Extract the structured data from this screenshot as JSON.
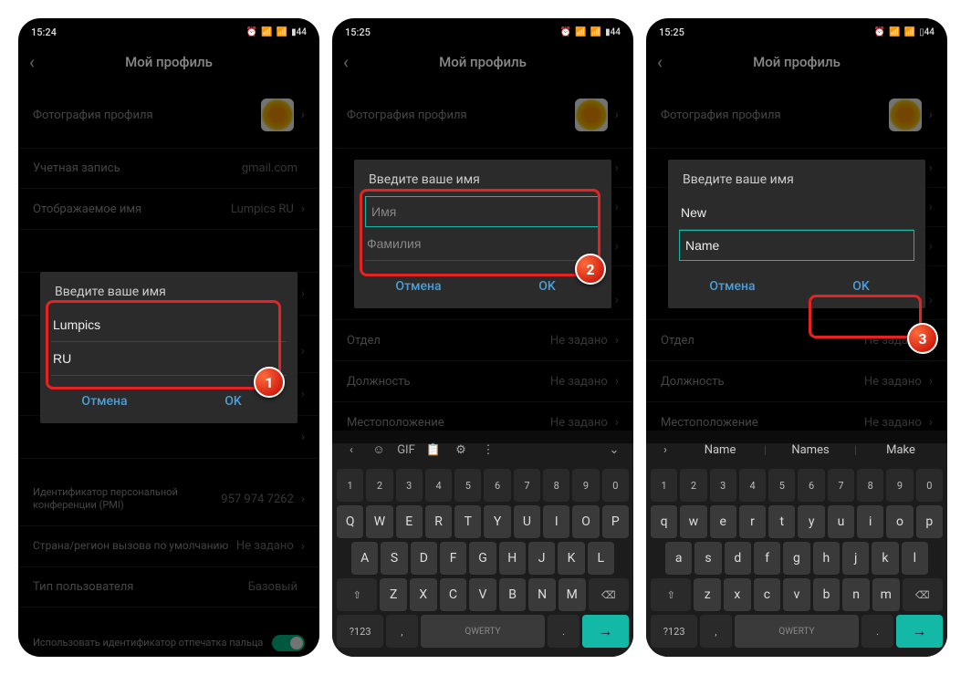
{
  "screens": [
    {
      "time": "15:24",
      "battery": "44",
      "title": "Мой профиль",
      "rows": {
        "photo": "Фотография профиля",
        "account": {
          "label": "Учетная запись",
          "value": "gmail.com"
        },
        "display_name": {
          "label": "Отображаемое имя",
          "value": "Lumpics RU"
        },
        "pmi": {
          "label": "Идентификатор персональной конференции (PMI)",
          "value": "957 974 7262"
        },
        "region": {
          "label": "Страна/регион вызова по умолчанию",
          "value": "Не задано"
        },
        "user_type": {
          "label": "Тип пользователя",
          "value": "Базовый"
        },
        "fingerprint": "Использовать идентификатор отпечатка пальца"
      },
      "dialog": {
        "title": "Введите ваше имя",
        "first_name": "Lumpics",
        "last_name": "RU",
        "cancel": "Отмена",
        "ok": "OK"
      },
      "badge": "1"
    },
    {
      "time": "15:25",
      "battery": "44",
      "title": "Мой профиль",
      "rows": {
        "photo": "Фотография профиля",
        "dept": {
          "label": "Отдел",
          "value": "Не задано"
        },
        "position": {
          "label": "Должность",
          "value": "Не задано"
        },
        "location": {
          "label": "Местоположение",
          "value": "Не задано"
        }
      },
      "dialog": {
        "title": "Введите ваше имя",
        "first_placeholder": "Имя",
        "last_placeholder": "Фамилия",
        "cancel": "Отмена",
        "ok": "OK"
      },
      "keyboard": {
        "suggest_icons": [
          "‹",
          "☺",
          "GIF",
          "📋",
          "⚙",
          "⋮",
          "⌄"
        ],
        "row_num": [
          "1",
          "2",
          "3",
          "4",
          "5",
          "6",
          "7",
          "8",
          "9",
          "0"
        ],
        "row1": [
          "Q",
          "W",
          "E",
          "R",
          "T",
          "Y",
          "U",
          "I",
          "O",
          "P"
        ],
        "row2": [
          "A",
          "S",
          "D",
          "F",
          "G",
          "H",
          "J",
          "K",
          "L"
        ],
        "row3_shift": "⇧",
        "row3": [
          "Z",
          "X",
          "C",
          "V",
          "B",
          "N",
          "M"
        ],
        "row3_del": "⌫",
        "sym": "?123",
        "comma": ",",
        "space": "QWERTY",
        "period": ".",
        "enter": "→"
      },
      "badge": "2"
    },
    {
      "time": "15:25",
      "battery": "44",
      "title": "Мой профиль",
      "rows": {
        "photo": "Фотография профиля",
        "dept": {
          "label": "Отдел",
          "value": "Не задано"
        },
        "position": {
          "label": "Должность",
          "value": "Не задано"
        },
        "location": {
          "label": "Местоположение",
          "value": "Не задано"
        }
      },
      "dialog": {
        "title": "Введите ваше имя",
        "first_name": "New",
        "last_name": "Name",
        "cancel": "Отмена",
        "ok": "OK"
      },
      "keyboard": {
        "suggest": [
          "Name",
          "Names",
          "Make"
        ],
        "row_num": [
          "1",
          "2",
          "3",
          "4",
          "5",
          "6",
          "7",
          "8",
          "9",
          "0"
        ],
        "row1": [
          "q",
          "w",
          "e",
          "r",
          "t",
          "y",
          "u",
          "i",
          "o",
          "p"
        ],
        "row2": [
          "a",
          "s",
          "d",
          "f",
          "g",
          "h",
          "j",
          "k",
          "l"
        ],
        "row3_shift": "⇧",
        "row3": [
          "z",
          "x",
          "c",
          "v",
          "b",
          "n",
          "m"
        ],
        "row3_del": "⌫",
        "sym": "?123",
        "comma": ",",
        "space": "QWERTY",
        "period": ".",
        "enter": "→"
      },
      "badge": "3"
    }
  ]
}
